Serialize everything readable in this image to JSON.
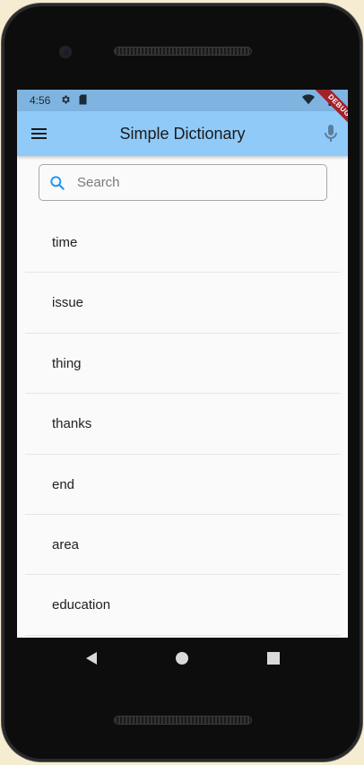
{
  "status_bar": {
    "time": "4:56"
  },
  "app_bar": {
    "title": "Simple Dictionary",
    "debug_label": "DEBUG"
  },
  "search": {
    "placeholder": "Search",
    "value": ""
  },
  "words": [
    "time",
    "issue",
    "thing",
    "thanks",
    "end",
    "area",
    "education"
  ],
  "icons": {
    "menu": "menu-icon",
    "mic": "mic-icon",
    "search": "search-icon",
    "nav_back": "back-triangle-icon",
    "nav_home": "home-circle-icon",
    "nav_recents": "recents-square-icon"
  },
  "colors": {
    "app_bar": "#90caf9",
    "status_bar": "#7fb4e0",
    "search_icon": "#2196f3",
    "debug_ribbon": "#a3212b"
  }
}
